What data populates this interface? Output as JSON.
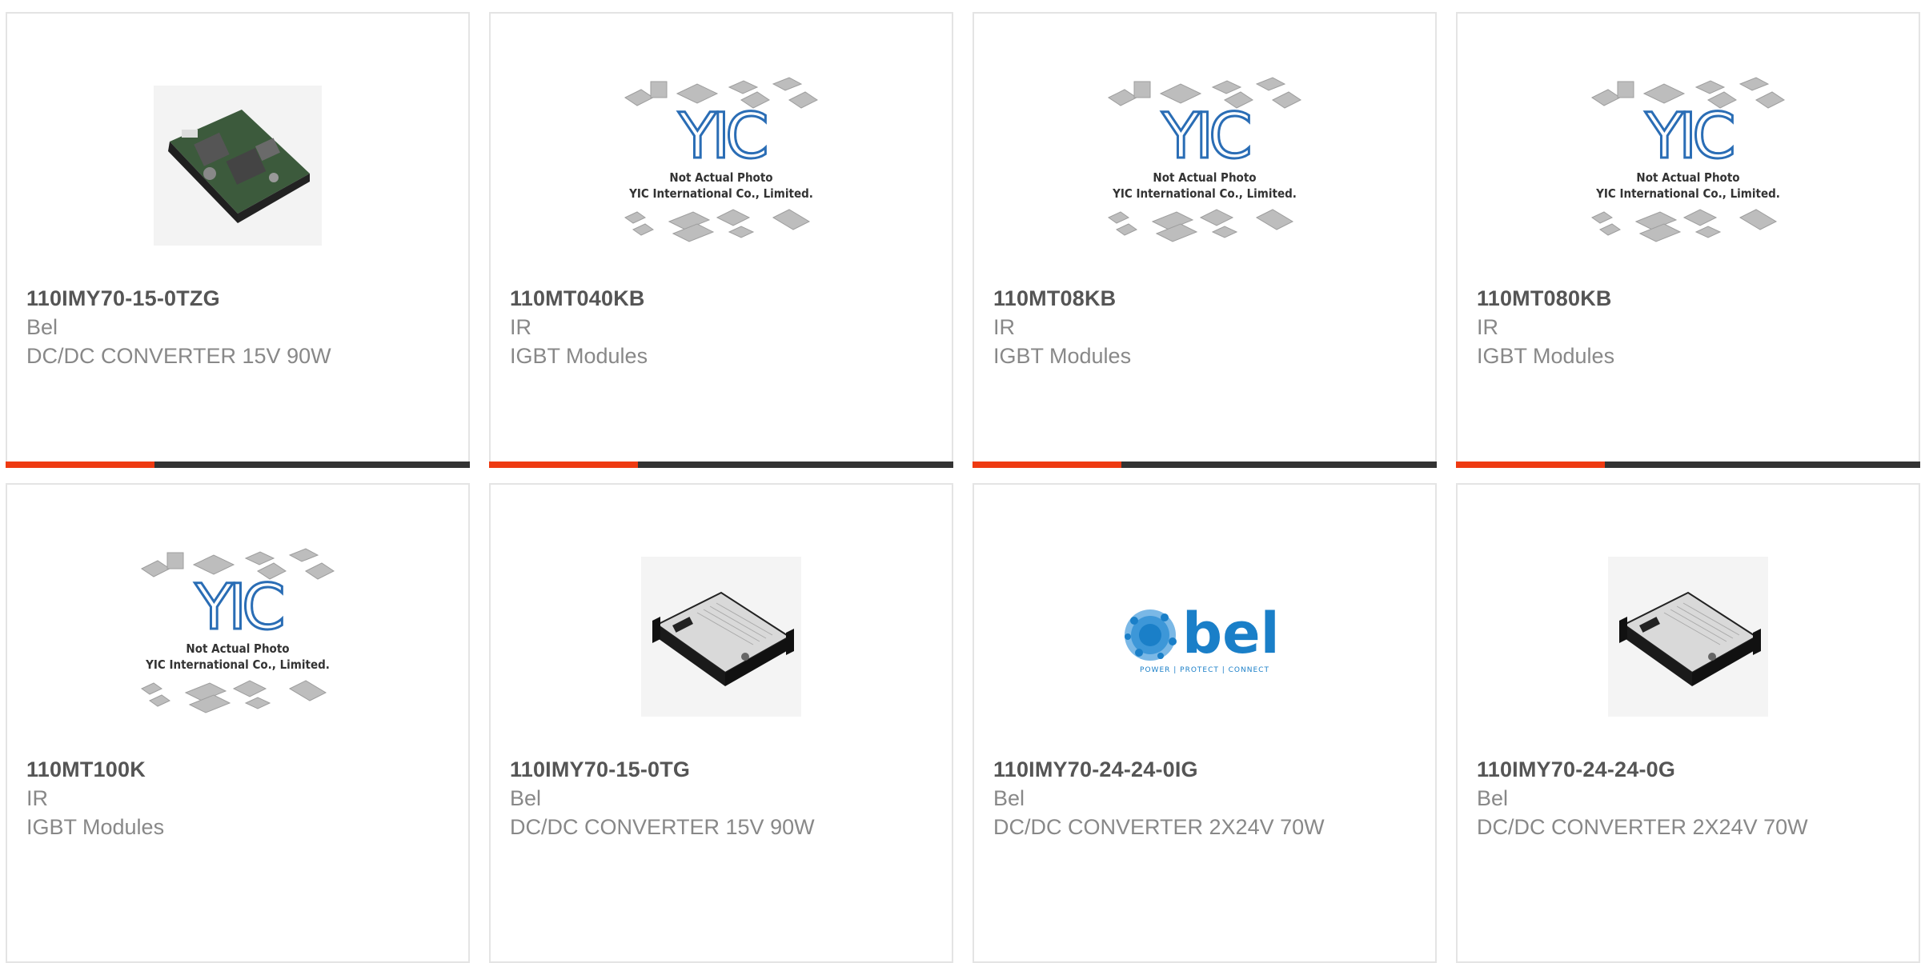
{
  "products": [
    {
      "part": "110IMY70-15-0TZG",
      "brand": "Bel",
      "description": "DC/DC CONVERTER 15V 90W",
      "image": "converter-board-photo"
    },
    {
      "part": "110MT040KB",
      "brand": "IR",
      "description": "IGBT Modules",
      "image": "yic-placeholder"
    },
    {
      "part": "110MT08KB",
      "brand": "IR",
      "description": "IGBT Modules",
      "image": "yic-placeholder"
    },
    {
      "part": "110MT080KB",
      "brand": "IR",
      "description": "IGBT Modules",
      "image": "yic-placeholder"
    },
    {
      "part": "110MT100K",
      "brand": "IR",
      "description": "IGBT Modules",
      "image": "yic-placeholder"
    },
    {
      "part": "110IMY70-15-0TG",
      "brand": "Bel",
      "description": "DC/DC CONVERTER 15V 90W",
      "image": "converter-module-photo"
    },
    {
      "part": "110IMY70-24-24-0IG",
      "brand": "Bel",
      "description": "DC/DC CONVERTER 2X24V 70W",
      "image": "bel-logo"
    },
    {
      "part": "110IMY70-24-24-0G",
      "brand": "Bel",
      "description": "DC/DC CONVERTER 2X24V 70W",
      "image": "converter-module-photo"
    }
  ],
  "placeholder": {
    "line1": "Not Actual Photo",
    "line2": "YIC International Co., Limited.",
    "logo": "YIC"
  },
  "bel_logo": {
    "wordmark": "bel",
    "tagline": "POWER | PROTECT | CONNECT"
  },
  "colors": {
    "accent": "#ee3a12",
    "bar": "#333333",
    "bel_blue": "#1a7fc8",
    "yic_blue": "#2a6db5"
  }
}
